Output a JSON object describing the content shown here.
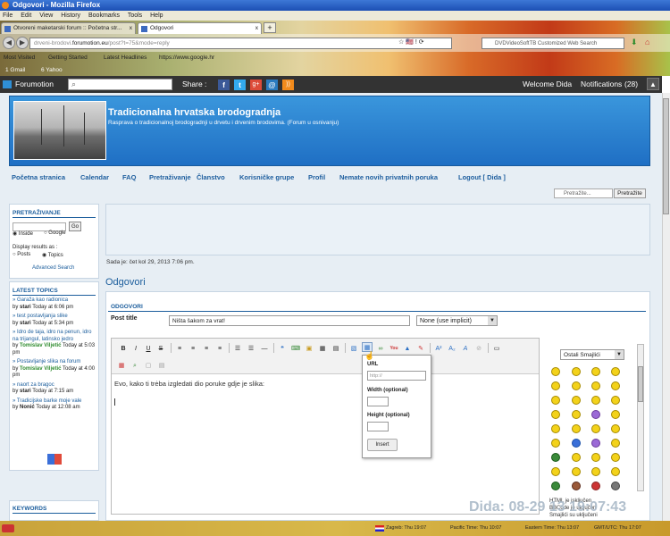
{
  "browser": {
    "title": "Odgovori - Mozilla Firefox",
    "menu": [
      "File",
      "Edit",
      "View",
      "History",
      "Bookmarks",
      "Tools",
      "Help"
    ],
    "tabs": [
      {
        "label": "Otvoreni maketarski forum :: Početna str...",
        "close": "x"
      },
      {
        "label": "Odgovori",
        "close": "x"
      }
    ],
    "new_tab": "+",
    "back": "◀",
    "forward": "▶",
    "url_host": "drveni-brodovi.",
    "url_bold": "forumotion.eu",
    "url_rest": "/post?t=75&mode=reply",
    "url_icons": "☆ 🇺🇸 ! ⟳",
    "search_placeholder": "DVDVideoSoftTB Customized Web Search",
    "bookmarks": [
      "Most Visited",
      "Getting Started",
      "Latest Headlines",
      "https://www.google.hr"
    ],
    "mail": [
      "1 Gmail",
      "6 Yahoo"
    ]
  },
  "forumbar": {
    "logo": "Forumotion",
    "share": "Share :",
    "welcome": "Welcome Dida",
    "notifications": "Notifications",
    "notif_count": "(28)",
    "top_arrow": "▲"
  },
  "site": {
    "title": "Tradicionalna hrvatska brodogradnja",
    "desc": "Rasprava o tradicionalnoj brodogradnji u drvetu i drvenim brodovima. (Forum u osnivanju)"
  },
  "nav": [
    "Početna stranica",
    "Calendar",
    "FAQ",
    "Pretraživanje",
    "Članstvo",
    "Korisničke grupe",
    "Profil",
    "Nemate novih privatnih poruka",
    "Logout [ Dida ]"
  ],
  "quicksearch": {
    "placeholder": "Pretražite...",
    "button": "Pretražite"
  },
  "sidebar": {
    "search_title": "PRETRAŽIVANJE",
    "go": "Go",
    "inside": "Inside",
    "google": "Google",
    "display": "Display results as :",
    "posts": "Posts",
    "topics": "Topics",
    "advanced": "Advanced Search",
    "latest_title": "LATEST TOPICS",
    "topics_list": [
      {
        "t": "Garaža kao radionica",
        "by": "stari",
        "when": "Today at 6:06 pm"
      },
      {
        "t": "test postavljanja slike",
        "by": "stari",
        "when": "Today at 5:34 pm"
      },
      {
        "t": "Idro de taja, idro na penun, idro na trijangul, latinsko jedro",
        "by": "Tomislav Viljetić",
        "when": "Today at 5:03 pm"
      },
      {
        "t": "Postavljanje slika na forum",
        "by": "Tomislav Viljetić",
        "when": "Today at 4:00 pm"
      },
      {
        "t": "naort za bragoc",
        "by": "stari",
        "when": "Today at 7:15 am"
      },
      {
        "t": "Tradicijske barke moje vale",
        "by": "Nonić",
        "when": "Today at 12:08 am"
      }
    ],
    "by_label": "by",
    "keywords_title": "KEYWORDS"
  },
  "main": {
    "sada_je": "Sada je: čet kol 29, 2013 7:06 pm.",
    "page_title": "Odgovori",
    "section": "ODGOVORI",
    "post_title_label": "Post title",
    "post_title_value": "Ništa šakom za vrat!",
    "icon_select": "None (use implicit)",
    "editor_text": "Evo, kako ti trėba izgledati dio poruke gdje je slika:",
    "popup": {
      "url_label": "URL",
      "url_placeholder": "http://",
      "width_label": "Width (optional)",
      "height_label": "Height (optional)",
      "insert": "Insert"
    },
    "smilies_select": "Ostali Smajlići",
    "html_status": "HTML je isključen",
    "bbcode_status": "BBCode je uključen",
    "smilies_status": "Smajlići su uključeni",
    "html_word": "isključen",
    "bb_word": "uključen",
    "sm_word": "uključeni",
    "watermark": "Dida: 08-29 13 19:07:43"
  },
  "statusbar": {
    "zagreb": "Zagreb: Thu 19:07",
    "pacific": "Pacific Time: Thu 10:07",
    "eastern": "Eastern Time: Thu 13:07",
    "gmt": "GMT/UTC: Thu 17:07"
  }
}
